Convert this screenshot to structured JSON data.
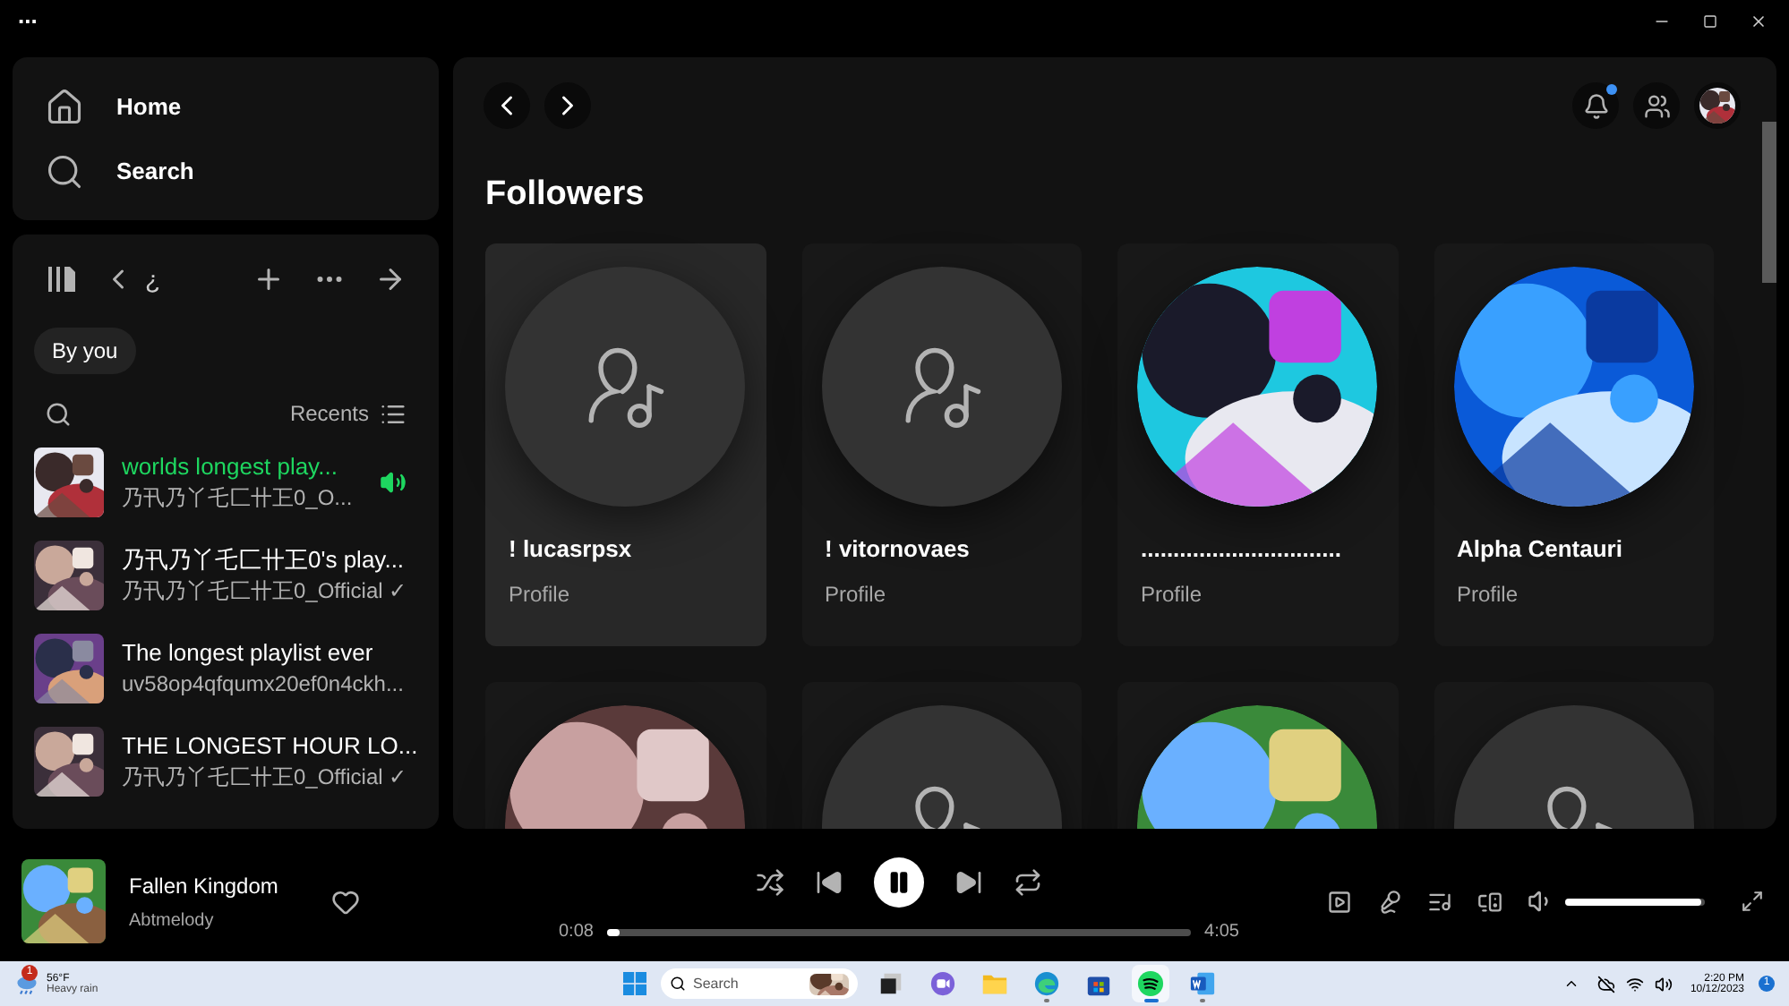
{
  "title_bar": {
    "menu": "..."
  },
  "nav": [
    {
      "label": "Home",
      "kind": "home"
    },
    {
      "label": "Search",
      "kind": "search"
    }
  ],
  "library": {
    "toolbar_text": "¿",
    "filter": "By you",
    "sort": "Recents",
    "items": [
      {
        "title": "worlds longest play...",
        "subtitle": "乃卂乃丫乇匚卄㠪0_O...",
        "playing": true
      },
      {
        "title": "乃卂乃丫乇匚卄㠪0's play...",
        "subtitle": "乃卂乃丫乇匚卄㠪0_Official ✓",
        "playing": false
      },
      {
        "title": "The longest playlist ever",
        "subtitle": "uv58op4qfqumx20ef0n4ckh...",
        "playing": false
      },
      {
        "title": "THE LONGEST HOUR LO...",
        "subtitle": "乃卂乃丫乇匚卄㠪0_Official ✓",
        "playing": false
      }
    ]
  },
  "header": {
    "notifications_unread": true
  },
  "followers": {
    "title": "Followers",
    "cards": [
      {
        "name": "! lucasrpsx",
        "subtitle": "Profile",
        "kind": "placeholder",
        "highlighted": true
      },
      {
        "name": "! vitornovaes",
        "subtitle": "Profile",
        "kind": "placeholder",
        "highlighted": false
      },
      {
        "name": "...............................",
        "subtitle": "Profile",
        "kind": "picture",
        "highlighted": false
      },
      {
        "name": "Alpha Centauri",
        "subtitle": "Profile",
        "kind": "picture",
        "highlighted": false
      }
    ],
    "more_cards": [
      {
        "kind": "picture"
      },
      {
        "kind": "placeholder"
      },
      {
        "kind": "picture"
      },
      {
        "kind": "placeholder"
      }
    ]
  },
  "player": {
    "track": "Fallen Kingdom",
    "artist": "Abtmelody",
    "liked": false,
    "elapsed": "0:08",
    "total": "4:05",
    "progress": {
      "level": 0.02
    },
    "volume": {
      "level": 0.98
    }
  },
  "taskbar": {
    "temperature": "56°F",
    "weather": "Heavy rain",
    "weather_badge": "1",
    "search_placeholder": "Search",
    "apps": [
      {
        "kind": "taskview",
        "active": false,
        "running": false
      },
      {
        "kind": "chat",
        "active": false,
        "running": false
      },
      {
        "kind": "folder",
        "active": false,
        "running": false
      },
      {
        "kind": "browser",
        "active": false,
        "running": true
      },
      {
        "kind": "store",
        "active": false,
        "running": false
      },
      {
        "kind": "music",
        "active": true,
        "running": true
      },
      {
        "kind": "document",
        "active": false,
        "running": true
      }
    ],
    "time": "2:20 PM",
    "date": "10/12/2023",
    "notification_count": "1"
  }
}
